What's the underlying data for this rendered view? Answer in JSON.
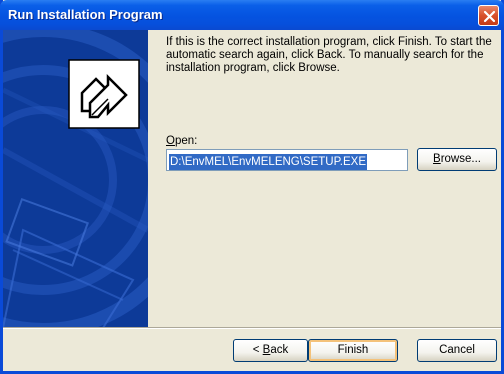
{
  "window": {
    "title": "Run Installation Program"
  },
  "main": {
    "description": "If this is the correct installation program, click Finish. To start the automatic search again, click Back. To manually search for the installation program, click Browse.",
    "open_label_first": "O",
    "open_label_rest": "pen:",
    "path_value": "D:\\EnvMEL\\EnvMELENG\\SETUP.EXE",
    "browse_first": "B",
    "browse_rest": "rowse..."
  },
  "footer": {
    "back_prefix": "< ",
    "back_ul": "B",
    "back_rest": "ack",
    "finish_label": "Finish",
    "cancel_label": "Cancel"
  },
  "colors": {
    "titlebar": "#0553e0",
    "left_panel": "#0d3a98",
    "selection": "#316ac5",
    "dialog_bg": "#ece9d8"
  },
  "icons": {
    "close": "close-icon",
    "install": "install-arrow-icon"
  }
}
